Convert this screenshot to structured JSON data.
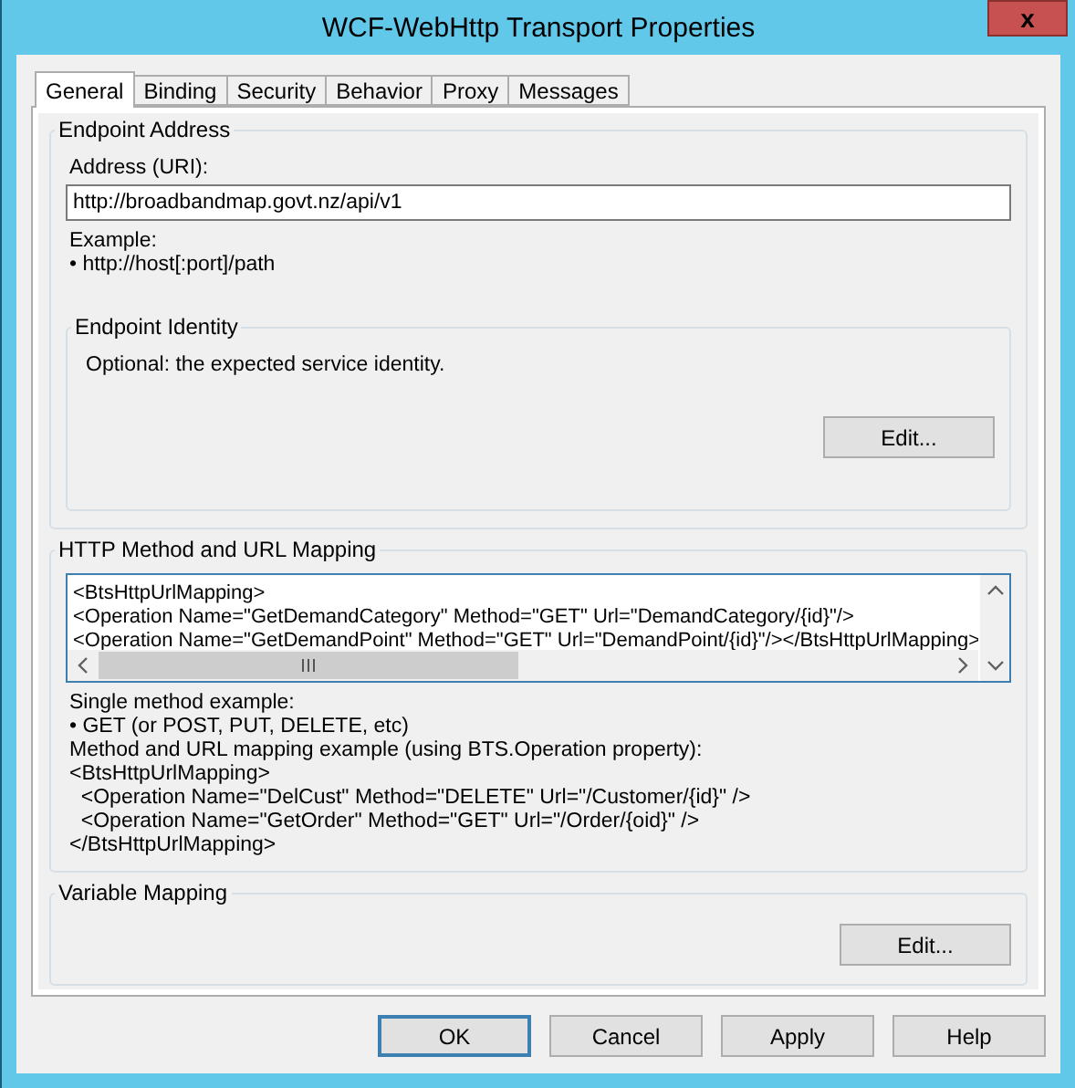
{
  "window": {
    "title": "WCF-WebHttp Transport Properties",
    "close": "x"
  },
  "tabs": [
    {
      "label": "General",
      "selected": true
    },
    {
      "label": "Binding",
      "selected": false
    },
    {
      "label": "Security",
      "selected": false
    },
    {
      "label": "Behavior",
      "selected": false
    },
    {
      "label": "Proxy",
      "selected": false
    },
    {
      "label": "Messages",
      "selected": false
    }
  ],
  "endpoint_address": {
    "title": "Endpoint Address",
    "address_label": "Address (URI):",
    "address_value": "http://broadbandmap.govt.nz/api/v1",
    "example_lines": [
      "Example:",
      "• http://host[:port]/path"
    ],
    "endpoint_identity": {
      "title": "Endpoint Identity",
      "text": "Optional: the expected service identity.",
      "button": "Edit..."
    }
  },
  "http_mapping": {
    "title": "HTTP Method and URL Mapping",
    "editor_lines": [
      "<BtsHttpUrlMapping>",
      "<Operation Name=\"GetDemandCategory\" Method=\"GET\" Url=\"DemandCategory/{id}\"/>",
      "<Operation Name=\"GetDemandPoint\" Method=\"GET\" Url=\"DemandPoint/{id}\"/></BtsHttpUrlMapping>"
    ],
    "help_lines": [
      "Single method example:",
      "• GET (or POST, PUT, DELETE, etc)",
      "Method and URL mapping example (using BTS.Operation property):",
      "<BtsHttpUrlMapping>",
      "  <Operation Name=\"DelCust\" Method=\"DELETE\" Url=\"/Customer/{id}\" />",
      "  <Operation Name=\"GetOrder\" Method=\"GET\" Url=\"/Order/{oid}\" />",
      "</BtsHttpUrlMapping>"
    ]
  },
  "variable_mapping": {
    "title": "Variable Mapping",
    "button": "Edit..."
  },
  "buttons": [
    {
      "label": "OK",
      "default": true
    },
    {
      "label": "Cancel",
      "default": false
    },
    {
      "label": "Apply",
      "default": false
    },
    {
      "label": "Help",
      "default": false
    }
  ]
}
